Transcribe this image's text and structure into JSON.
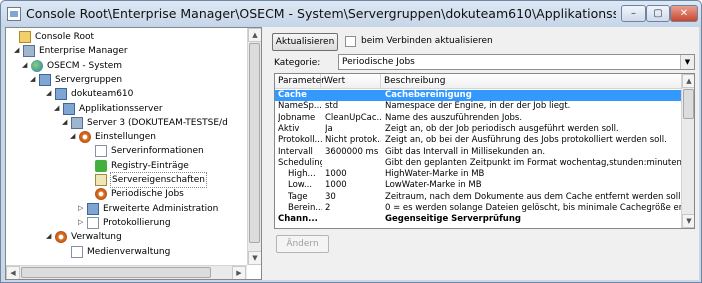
{
  "window": {
    "title": "Console Root\\Enterprise Manager\\OSECM - System\\Servergruppen\\dokuteam610\\Applikationsserver\\Server 3 (D...",
    "buttons": {
      "minimize": "–",
      "maximize": "▢",
      "close": "✕"
    }
  },
  "tree": {
    "items": [
      {
        "label": "Console Root",
        "icon": "folder-icon",
        "expander": ""
      },
      {
        "label": "Enterprise Manager",
        "icon": "server-icon",
        "expander": "◢"
      },
      {
        "label": "OSECM - System",
        "icon": "globe-icon",
        "expander": "◢"
      },
      {
        "label": "Servergruppen",
        "icon": "group-icon",
        "expander": "◢"
      },
      {
        "label": "dokuteam610",
        "icon": "group-icon",
        "expander": "◢"
      },
      {
        "label": "Applikationsserver",
        "icon": "group-icon",
        "expander": "◢"
      },
      {
        "label": "Server 3 (DOKUTEAM-TESTSE/d",
        "icon": "server-check-icon",
        "expander": "◢"
      },
      {
        "label": "Einstellungen",
        "icon": "gear-icon",
        "expander": "◢"
      },
      {
        "label": "Serverinformationen",
        "icon": "page-icon",
        "expander": ""
      },
      {
        "label": "Registry-Einträge",
        "icon": "registry-icon",
        "expander": ""
      },
      {
        "label": "Servereigenschaften",
        "icon": "edit-icon",
        "expander": ""
      },
      {
        "label": "Periodische Jobs",
        "icon": "gear-icon",
        "expander": ""
      },
      {
        "label": "Erweiterte Administration",
        "icon": "group-icon",
        "expander": "▷"
      },
      {
        "label": "Protokollierung",
        "icon": "page-icon",
        "expander": "▷"
      },
      {
        "label": "Verwaltung",
        "icon": "gear-icon",
        "expander": "◢"
      },
      {
        "label": "Medienverwaltung",
        "icon": "page-icon",
        "expander": ""
      }
    ]
  },
  "toolbar": {
    "refresh_label": "Aktualisieren",
    "refresh_on_connect_label": "beim Verbinden aktualisieren",
    "category_label": "Kategorie:",
    "category_value": "Periodische Jobs"
  },
  "grid": {
    "columns": [
      "Parameter",
      "Wert",
      "Beschreibung"
    ],
    "rows": [
      {
        "type": "section",
        "param": "Cache",
        "value": "",
        "desc": "Cachebereinigung"
      },
      {
        "type": "row",
        "param": "NameSp...",
        "value": "std",
        "desc": "Namespace der Engine, in der der Job liegt."
      },
      {
        "type": "row",
        "param": "Jobname",
        "value": "CleanUpCac...",
        "desc": "Name des auszuführenden Jobs."
      },
      {
        "type": "row",
        "param": "Aktiv",
        "value": "Ja",
        "desc": "Zeigt an, ob der Job periodisch ausgeführt werden soll."
      },
      {
        "type": "row",
        "param": "Protokoll...",
        "value": "Nicht protok...",
        "desc": "Zeigt an, ob bei der Ausführung des Jobs protokolliert werden soll."
      },
      {
        "type": "row",
        "param": "Intervall",
        "value": "3600000 ms",
        "desc": "Gibt das Intervall in Millisekunden an."
      },
      {
        "type": "row",
        "param": "Scheduling",
        "value": "",
        "desc": "Gibt den geplanten Zeitpunkt im Format wochentag,stunden:minuten:sekunde"
      },
      {
        "type": "sub",
        "param": "High...",
        "value": "1000",
        "desc": "HighWater-Marke in MB"
      },
      {
        "type": "sub",
        "param": "Low...",
        "value": "1000",
        "desc": "LowWater-Marke in MB"
      },
      {
        "type": "sub",
        "param": "Tage",
        "value": "30",
        "desc": "Zeitraum, nach dem Dokumente aus dem Cache entfernt werden sollen."
      },
      {
        "type": "sub",
        "param": "Berein...",
        "value": "2",
        "desc": "0 = es werden solange Dateien gelöscht, bis minimale Cachegröße erreicht ist,"
      },
      {
        "type": "section2",
        "param": "Chann...",
        "value": "",
        "desc": "Gegenseitige Serverprüfung"
      }
    ]
  },
  "footer": {
    "change_label": "Ändern"
  }
}
